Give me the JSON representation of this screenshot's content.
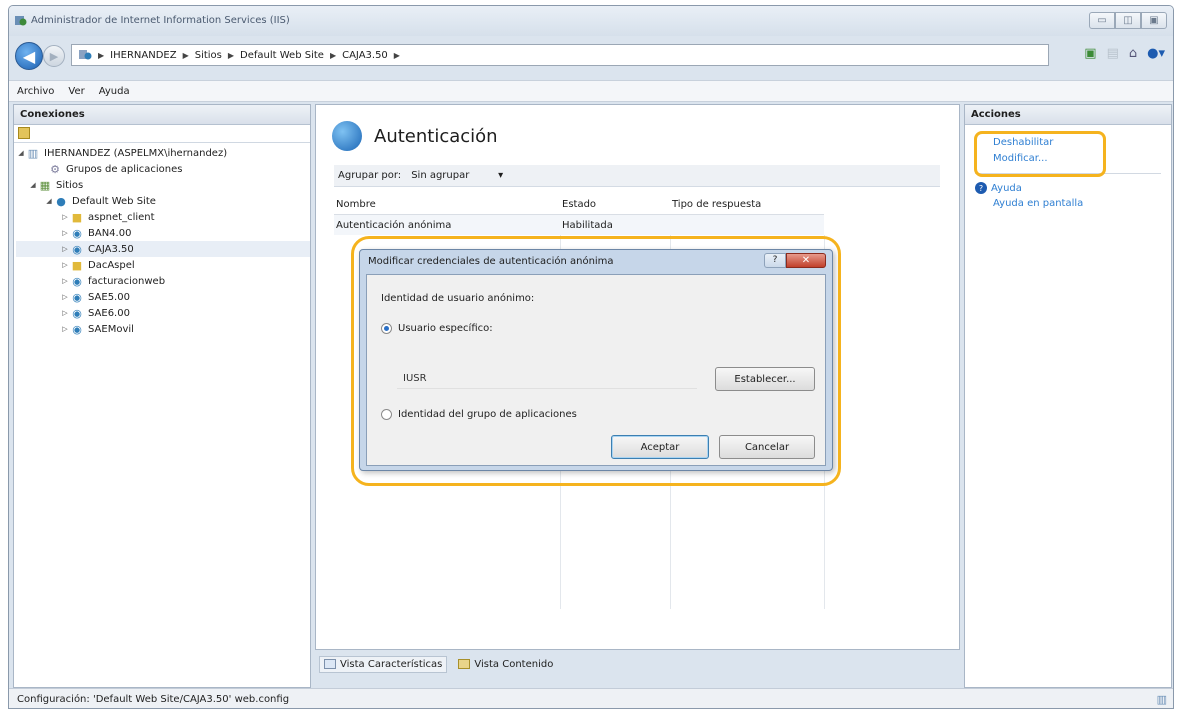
{
  "window": {
    "title": "Administrador de Internet Information Services (IIS)"
  },
  "breadcrumb": [
    "IHERNANDEZ",
    "Sitios",
    "Default Web Site",
    "CAJA3.50"
  ],
  "menu": [
    "Archivo",
    "Ver",
    "Ayuda"
  ],
  "connections": {
    "header": "Conexiones",
    "tree": [
      {
        "label": "IHERNANDEZ (ASPELMX\\ihernandez)",
        "level": 0,
        "toggle": "◢",
        "icon": "server-icon"
      },
      {
        "label": "Grupos de aplicaciones",
        "level": 1,
        "toggle": "",
        "icon": "app-pool-icon"
      },
      {
        "label": "Sitios",
        "level": 1,
        "toggle": "◢",
        "icon": "sites-icon"
      },
      {
        "label": "Default Web Site",
        "level": 2,
        "toggle": "◢",
        "icon": "globe-icon"
      },
      {
        "label": "aspnet_client",
        "level": 3,
        "toggle": "▷",
        "icon": "folder-icon"
      },
      {
        "label": "BAN4.00",
        "level": 3,
        "toggle": "▷",
        "icon": "web-app-icon"
      },
      {
        "label": "CAJA3.50",
        "level": 3,
        "toggle": "▷",
        "icon": "web-app-icon"
      },
      {
        "label": "DacAspel",
        "level": 3,
        "toggle": "▷",
        "icon": "folder-icon"
      },
      {
        "label": "facturacionweb",
        "level": 3,
        "toggle": "▷",
        "icon": "web-app-icon"
      },
      {
        "label": "SAE5.00",
        "level": 3,
        "toggle": "▷",
        "icon": "web-app-icon"
      },
      {
        "label": "SAE6.00",
        "level": 3,
        "toggle": "▷",
        "icon": "web-app-icon"
      },
      {
        "label": "SAEMovil",
        "level": 3,
        "toggle": "▷",
        "icon": "web-app-icon"
      }
    ]
  },
  "main": {
    "title": "Autenticación",
    "group_by_label": "Agrupar por:",
    "group_by_value": "Sin agrupar",
    "columns": [
      "Nombre",
      "Estado",
      "Tipo de respuesta"
    ],
    "rows": [
      {
        "name": "Autenticación anónima",
        "state": "Habilitada",
        "response": ""
      }
    ],
    "tabs": [
      "Vista Características",
      "Vista Contenido"
    ]
  },
  "actions": {
    "header": "Acciones",
    "items": [
      "Deshabilitar",
      "Modificar..."
    ],
    "help": [
      "Ayuda",
      "Ayuda en pantalla"
    ]
  },
  "dialog": {
    "title": "Modificar credenciales de autenticación anónima",
    "help_btn": "?",
    "close_btn": "✕",
    "section_label": "Identidad de usuario anónimo:",
    "option_specific": "Usuario específico:",
    "user_value": "IUSR",
    "set_button": "Establecer...",
    "option_pool": "Identidad del grupo de aplicaciones",
    "ok_button": "Aceptar",
    "cancel_button": "Cancelar"
  },
  "status": {
    "text": "Configuración: 'Default Web Site/CAJA3.50' web.config"
  },
  "colors": {
    "highlight": "#f5b31e",
    "link": "#2f7fd2"
  }
}
